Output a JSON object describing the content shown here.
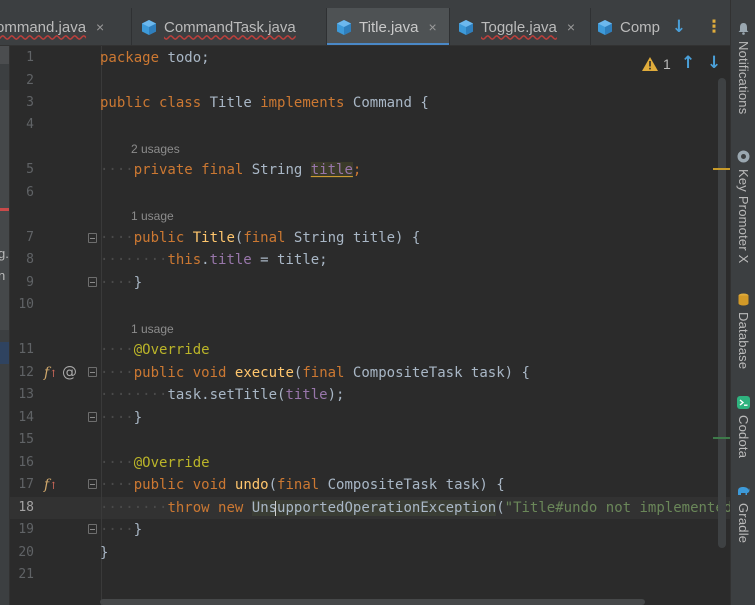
{
  "colors": {
    "accent": "#4a88c7",
    "java_cube": "#3d9ad9",
    "warning": "#e0ac3b",
    "keyword": "#cc7832",
    "string": "#6a8759",
    "field": "#9876aa",
    "annotation": "#bbb529",
    "method_decl": "#ffc66d",
    "error_wave": "#bc3f3c"
  },
  "top_fragment": "　　　　　　　　　　",
  "tabs": [
    {
      "label": "ommand.java",
      "icon": "java-class-icon",
      "closable": true,
      "active": false
    },
    {
      "label": "CommandTask.java",
      "icon": "java-class-icon",
      "closable": false,
      "active": false
    },
    {
      "label": "Title.java",
      "icon": "java-class-icon",
      "closable": true,
      "active": true
    },
    {
      "label": "Toggle.java",
      "icon": "java-class-icon",
      "closable": true,
      "active": false
    },
    {
      "label": "Comp",
      "icon": "java-class-icon",
      "closable": false,
      "active": false
    }
  ],
  "tab_close_glyph": "×",
  "tabbar_buttons": {
    "show_hidden_glyph": "↓",
    "more_glyph": "⋮"
  },
  "project_fragments": [
    "g.",
    "n"
  ],
  "inspection": {
    "warning_count": "1",
    "prev_glyph": "↑",
    "next_glyph": "↓"
  },
  "usages": [
    "2 usages",
    "1 usage",
    "1 usage"
  ],
  "editor": {
    "line_numbers": [
      "1",
      "2",
      "3",
      "4",
      "5",
      "6",
      "7",
      "8",
      "9",
      "10",
      "11",
      "12",
      "13",
      "14",
      "15",
      "16",
      "17",
      "18",
      "19",
      "20",
      "21"
    ],
    "current_line": "18",
    "code": {
      "l1_kw": "package",
      "l1_rest": " todo;",
      "l3_kw1": "public",
      "l3_kw2": "class",
      "l3_name": " Title ",
      "l3_kw3": "implements",
      "l3_rest": " Command {",
      "l5_kw1": "private",
      "l5_kw2": "final",
      "l5_type": " String ",
      "l5_field": "title",
      "l5_end": ";",
      "l7_kw": "public",
      "l7_name": "Title",
      "l7_open": "(",
      "l7_kw2": "final",
      "l7_rest": " String title) {",
      "l8_this": "this",
      "l8_dot": ".",
      "l8_field": "title",
      "l8_rest": " = title;",
      "l9": "}",
      "l11": "@Override",
      "l12_kw1": "public",
      "l12_kw2": "void",
      "l12_name": "execute",
      "l12_open": "(",
      "l12_kw3": "final",
      "l12_rest": " CompositeTask task) {",
      "l13_pre": "task.setTitle(",
      "l13_field": "title",
      "l13_post": ");",
      "l14": "}",
      "l16": "@Override",
      "l17_kw1": "public",
      "l17_kw2": "void",
      "l17_name": "undo",
      "l17_open": "(",
      "l17_kw3": "final",
      "l17_rest": " CompositeTask task) {",
      "l18_kw1": "throw",
      "l18_kw2": "new",
      "l18_cls": "UnsupportedOperationException",
      "l18_open": "(",
      "l18_str": "\"Title#undo not implemented.\"",
      "l18_end": ");",
      "l19": "}",
      "l20": "}"
    },
    "gutter": {
      "override_icon_glyph": "𝑓",
      "at_glyph": "@"
    }
  },
  "right_tools": [
    {
      "label": "Notifications",
      "icon": "bell-icon"
    },
    {
      "label": "Key Promoter X",
      "icon": "key-promoter-icon"
    },
    {
      "label": "Database",
      "icon": "database-icon"
    },
    {
      "label": "Codota",
      "icon": "codota-icon"
    },
    {
      "label": "Gradle",
      "icon": "gradle-elephant-icon"
    }
  ]
}
